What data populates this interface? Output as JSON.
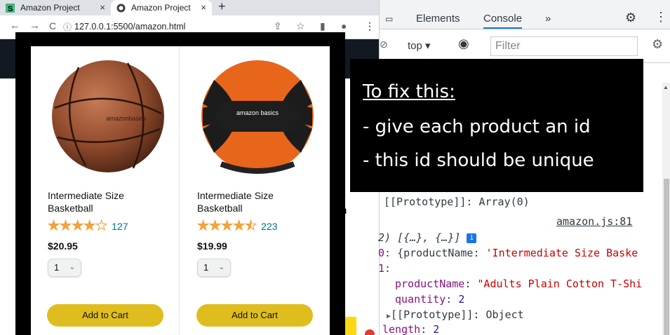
{
  "browser": {
    "tabs": [
      {
        "title": "Amazon Project",
        "close": "×"
      },
      {
        "title": "Amazon Project",
        "close": "×"
      }
    ],
    "new_tab": "+",
    "nav": {
      "back": "←",
      "forward": "→",
      "reload": "C"
    },
    "url": "127.0.0.1:5500/amazon.html"
  },
  "products": [
    {
      "name": "Intermediate Size Basketball",
      "rating": 4,
      "rating_count": "127",
      "price": "$20.95",
      "quantity": "1",
      "add_to_cart": "Add to Cart",
      "image_label": "amazonbasics"
    },
    {
      "name": "Intermediate Size Basketball",
      "rating": 4.5,
      "rating_count": "223",
      "price": "$19.99",
      "quantity": "1",
      "add_to_cart": "Add to Cart",
      "image_label": "amazon basics"
    }
  ],
  "background_text": "n",
  "devtools": {
    "tabs": {
      "elements": "Elements",
      "console": "Console",
      "more": "»"
    },
    "context": "top",
    "filter_placeholder": "Filter",
    "console_lines": {
      "prototype_array": "[[Prototype]]: Array(0)",
      "source_link": "amazon.js:81",
      "array_summary": "2) [{…}, {…}]",
      "item0_index": "0",
      "item0_key": "{productName",
      "item0_value": "'Intermediate Size Baske",
      "item1_index": "1",
      "product_name_key": "productName",
      "product_name_value": "\"Adults Plain Cotton T-Shi",
      "quantity_key": "quantity",
      "quantity_value": "2",
      "prototype_object": "[[Prototype]]: Object",
      "length_key": "length",
      "length_value": "2"
    }
  },
  "callout": {
    "heading": "To fix this:",
    "line1": "- give each product an id",
    "line2": "- this id should be unique"
  },
  "colors": {
    "add_to_cart": "#e0bd1f",
    "stars": "#f2a33a",
    "rating_count": "#007185",
    "console_key": "#881280",
    "console_string": "#c80000",
    "console_number": "#1a1aa6"
  }
}
